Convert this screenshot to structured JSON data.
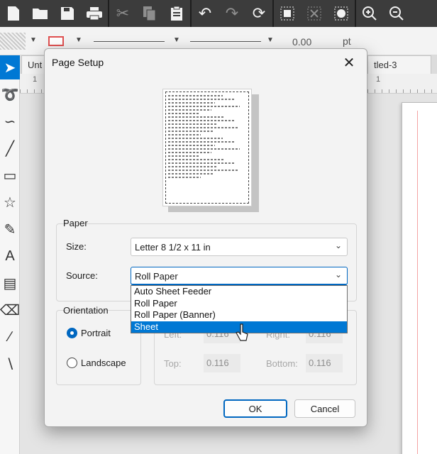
{
  "toolbar": {
    "icons": [
      "new-document-icon",
      "open-folder-icon",
      "save-icon",
      "print-icon",
      "cut-icon",
      "copy-icon",
      "paste-icon",
      "undo-icon",
      "redo-icon",
      "refresh-icon",
      "group-icon",
      "ungroup-icon",
      "palette-icon",
      "zoom-in-icon",
      "zoom-out-icon"
    ]
  },
  "propbar": {
    "line_width_value": "0.00",
    "line_width_unit": "pt"
  },
  "tabs": {
    "tab1_label": "Unt",
    "tab2_label": "tled-3",
    "ruler_numbers": [
      "1",
      "1"
    ]
  },
  "dialog": {
    "title": "Page Setup",
    "paper": {
      "group_label": "Paper",
      "size_label": "Size:",
      "size_value": "Letter 8 1/2 x 11 in",
      "source_label": "Source:",
      "source_value": "Roll Paper",
      "source_options": [
        "Auto Sheet Feeder",
        "Roll Paper",
        "Roll Paper (Banner)",
        "Sheet"
      ],
      "source_highlighted": "Sheet"
    },
    "orientation": {
      "group_label": "Orientation",
      "portrait_label": "Portrait",
      "landscape_label": "Landscape",
      "selected": "Portrait"
    },
    "margins": {
      "left_label": "Left:",
      "left_value": "0.116",
      "right_label": "Right:",
      "right_value": "0.116",
      "top_label": "Top:",
      "top_value": "0.116",
      "bottom_label": "Bottom:",
      "bottom_value": "0.116"
    },
    "ok_label": "OK",
    "cancel_label": "Cancel"
  },
  "colors": {
    "accent": "#0078d4",
    "toolbar_bg": "#3c3c3c",
    "dialog_bg": "#f3f3f3"
  }
}
